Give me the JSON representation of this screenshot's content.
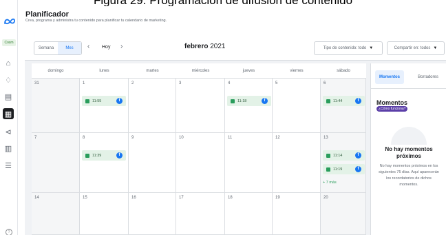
{
  "caption": "Figura 29. Programación de difusión de contenido",
  "header": {
    "title": "Planificador",
    "subtitle": "Crea, programa y administra tu contenido para planificar tu calendario de marketing."
  },
  "rail": {
    "avatar_text": "Cosm",
    "icons": [
      "home-icon",
      "notifications-icon",
      "content-icon",
      "planner-icon",
      "ads-icon",
      "insights-icon",
      "menu-icon"
    ],
    "help_label": "?"
  },
  "toolbar": {
    "view_week": "Semana",
    "view_month": "Mes",
    "today": "Hoy",
    "month_name": "febrero",
    "year": "2021",
    "content_type": "Tipo de contenido: todo",
    "share": "Compartir en: todos"
  },
  "calendar": {
    "days": [
      "domingo",
      "lunes",
      "martes",
      "miércoles",
      "jueves",
      "viernes",
      "sábado"
    ],
    "weeks": [
      [
        "31",
        "1",
        "2",
        "3",
        "4",
        "5",
        "6"
      ],
      [
        "7",
        "8",
        "9",
        "10",
        "11",
        "12",
        "13"
      ],
      [
        "14",
        "15",
        "16",
        "17",
        "18",
        "19",
        "20"
      ]
    ],
    "events": {
      "w0d1": "11:55",
      "w0d4": "11:18",
      "w0d6": "11:44",
      "w1d1": "11:39",
      "w1d6a": "11:14",
      "w1d6b": "11:19"
    },
    "more_label": "+ 7 más"
  },
  "right_panel": {
    "tab_moments": "Momentos",
    "tab_drafts": "Borradores",
    "heading": "Momentos",
    "help_pill": "¿Cómo funciona?",
    "empty_title": "No hay momentos próximos",
    "empty_desc": "No hay momentos próximos en los siguientes 75 días. Aquí aparecerán los recordatorios de dichos momentos."
  },
  "colors": {
    "accent": "#1877f2",
    "event_bg": "#e3f2e7",
    "event_icon": "#2a9d5c",
    "pill": "#5b3fa8"
  }
}
